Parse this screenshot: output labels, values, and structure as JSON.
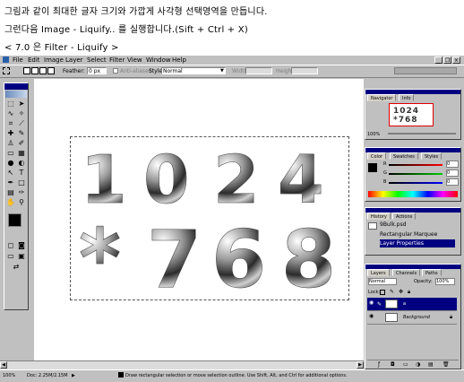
{
  "captions": {
    "line1": "그림과 같이 최대한 글자 크기와 가깝게 사각형 선택영역을 만듭니다.",
    "line2": "그런다음 Image - Liquify.. 를 실행합니다.(Sift + Ctrl + X)",
    "line3": "< 7.0 은 Filter - Liquify >"
  },
  "menubar": {
    "items": [
      "File",
      "Edit",
      "Image",
      "Layer",
      "Select",
      "Filter",
      "View",
      "Window",
      "Help"
    ],
    "minimize": "_",
    "restore": "❐",
    "close": "×"
  },
  "options_bar": {
    "feather_label": "Feather:",
    "feather_value": "0 px",
    "anti_aliased_label": "Anti-aliased",
    "style_label": "Style:",
    "style_value": "Normal",
    "width_label": "Width:",
    "height_label": "Height:"
  },
  "canvas": {
    "digits": [
      "1",
      "0",
      "2",
      "4",
      "*",
      "7",
      "6",
      "8"
    ]
  },
  "status_bar": {
    "zoom": "100%",
    "doc": "Doc: 2.25M/2.15M",
    "hint": "Draw rectangular selection or move selection outline. Use Shift, Alt, and Ctrl for additional options."
  },
  "navigator": {
    "tabs": [
      "Navigator",
      "Info"
    ],
    "zoom": "100%"
  },
  "color_panel": {
    "tabs": [
      "Color",
      "Swatches",
      "Styles"
    ],
    "r_label": "R",
    "g_label": "G",
    "b_label": "B",
    "r_value": "0",
    "g_value": "0",
    "b_value": "0"
  },
  "history": {
    "tabs": [
      "History",
      "Actions"
    ],
    "file": "9Bulk.psd",
    "items": [
      "Rectangular Marquee",
      "Layer Properties"
    ]
  },
  "layers": {
    "tabs": [
      "Layers",
      "Channels",
      "Paths"
    ],
    "blend": "Normal",
    "opacity_label": "Opacity:",
    "opacity_value": "100%",
    "lock_label": "Lock:",
    "rows": [
      "a",
      "Background"
    ]
  },
  "colors": {
    "title_bar": "#000080",
    "face": "#c0c0c0"
  }
}
